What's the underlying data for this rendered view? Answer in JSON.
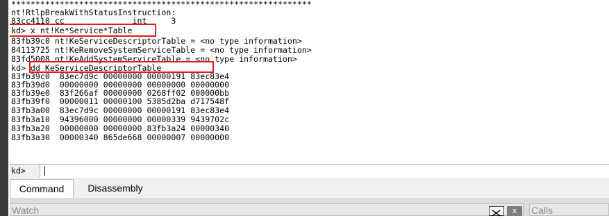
{
  "output": {
    "lines": [
      "**************************************************************",
      "nt!RtlpBreakWithStatusInstruction:",
      "83cc4110 cc              int     3",
      "kd> x nt!Ke*Service*Table",
      "83fb39c0 nt!KeServiceDescriptorTable = <no type information>",
      "84113725 nt!KeRemoveSystemServiceTable = <no type information>",
      "83fd5008 nt!KeAddSystemServiceTable = <no type information>",
      "kd> dd KeServiceDescriptorTable",
      "83fb39c0  83ec7d9c 00000000 00000191 83ec83e4",
      "83fb39d0  00000000 00000000 00000000 00000000",
      "83fb39e0  83f266af 00000000 0268ff02 000000bb",
      "83fb39f0  00000011 00000100 5385d2ba d717548f",
      "83fb3a00  83ec7d9c 00000000 00000191 83ec83e4",
      "83fb3a10  94396000 00000000 00000339 9439702c",
      "83fb3a20  00000000 00000000 83fb3a24 00000340",
      "83fb3a30  00000340 865de668 00000007 00000000"
    ]
  },
  "command_bar": {
    "prompt": "kd>",
    "value": ""
  },
  "tabs": [
    {
      "label": "Command",
      "active": true
    },
    {
      "label": "Disassembly",
      "active": false
    }
  ],
  "panes": {
    "watch_title": "Watch",
    "calls_title": "Calls",
    "close_glyph": "x"
  },
  "colors": {
    "highlight_box": "#e41b1b",
    "left_strip": "#3a3a3a"
  }
}
